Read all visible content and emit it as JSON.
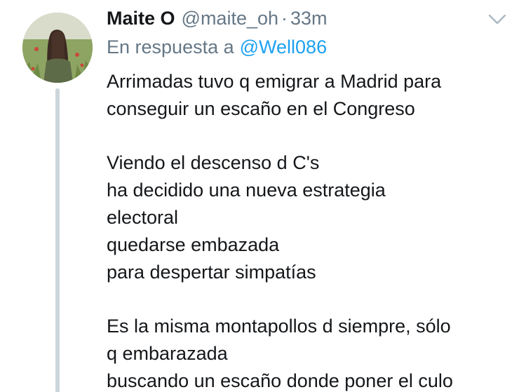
{
  "tweet": {
    "author": {
      "display_name": "Maite O",
      "handle": "@maite_oh",
      "avatar_icon": "profile-photo"
    },
    "separator": "·",
    "timestamp": "33m",
    "reply": {
      "prefix": "En respuesta a",
      "mention": "@Well086"
    },
    "menu_icon": "chevron-down-icon",
    "colors": {
      "name": "#14171a",
      "secondary": "#657786",
      "link": "#1da1f2",
      "thread_line": "#ccd6dd"
    },
    "paragraphs": [
      [
        "Arrimadas tuvo q emigrar a Madrid para",
        "conseguir un escaño en el Congreso"
      ],
      [
        "Viendo el descenso d C's",
        "ha decidido una nueva estrategia",
        "electoral",
        "quedarse embazada",
        "para despertar simpatías"
      ],
      [
        "Es la misma montapollos d siempre, sólo",
        "q embarazada",
        "buscando un escaño donde poner el culo"
      ]
    ]
  }
}
